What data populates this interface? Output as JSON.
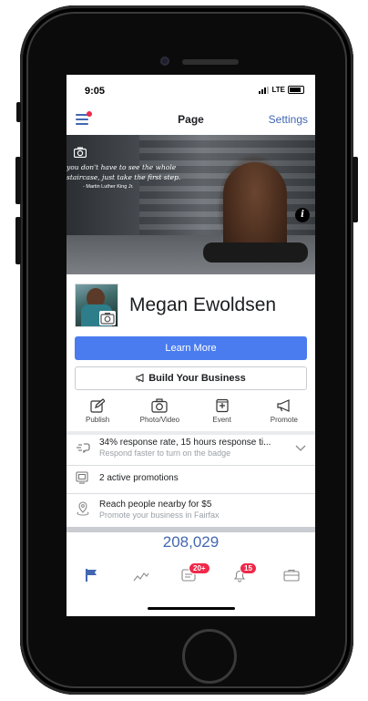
{
  "status_bar": {
    "time": "9:05",
    "network": "LTE"
  },
  "nav": {
    "title": "Page",
    "settings_label": "Settings"
  },
  "cover": {
    "quote_line1": "you don't have to see the whole",
    "quote_line2": "staircase, just take the first step.",
    "quote_author": "- Martin Luther King Jr."
  },
  "page": {
    "name": "Megan Ewoldsen"
  },
  "buttons": {
    "learn_more": "Learn More",
    "build_business": "Build Your Business"
  },
  "actions": [
    {
      "label": "Publish",
      "icon": "edit-icon"
    },
    {
      "label": "Photo/Video",
      "icon": "camera-icon"
    },
    {
      "label": "Event",
      "icon": "event-icon"
    },
    {
      "label": "Promote",
      "icon": "megaphone-icon"
    }
  ],
  "rows": {
    "response": {
      "title": "34% response rate, 15 hours response ti...",
      "subtitle": "Respond faster to turn on the badge"
    },
    "promotions": {
      "title": "2 active promotions"
    },
    "reach": {
      "title": "Reach people nearby for $5",
      "subtitle": "Promote your business in Fairfax"
    }
  },
  "stat": {
    "value": "208,029"
  },
  "tabs": {
    "badges": {
      "messages": "20+",
      "notifications": "15"
    }
  },
  "colors": {
    "brand_blue": "#4267b2",
    "button_blue": "#4a7cf0",
    "badge_red": "#f02849"
  }
}
